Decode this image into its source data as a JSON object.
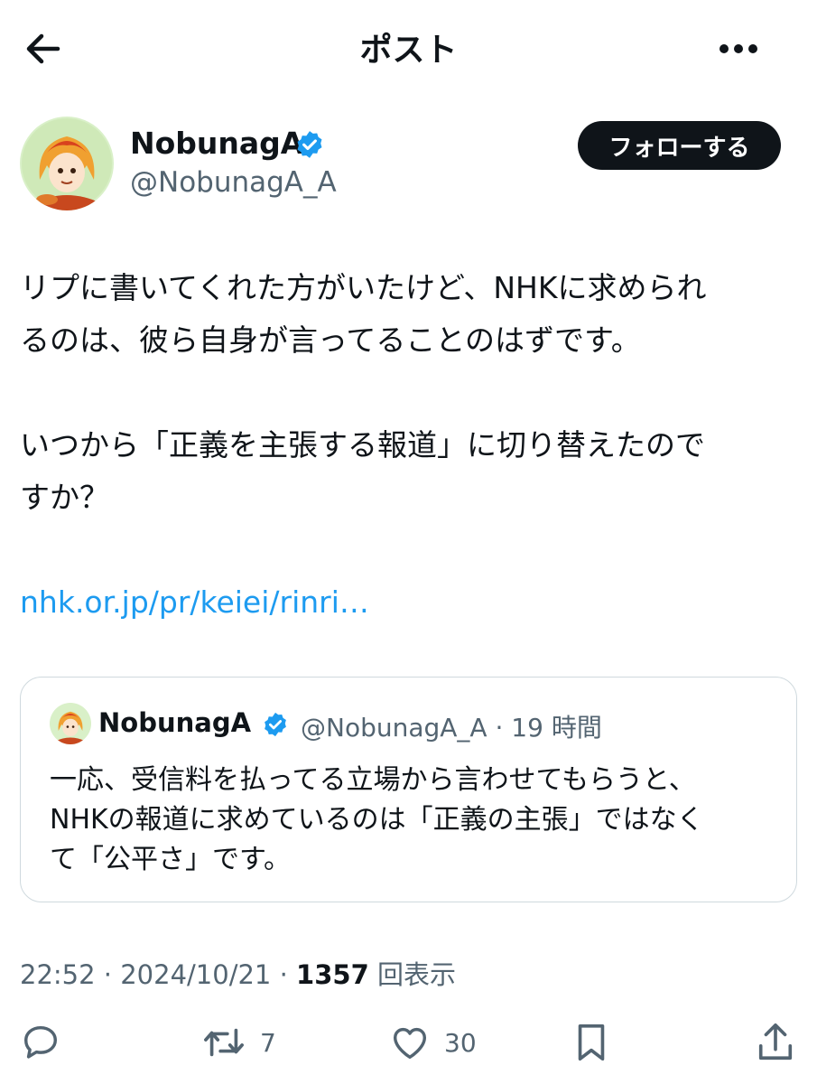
{
  "header": {
    "title": "ポスト"
  },
  "author": {
    "name": "NobunagA",
    "handle": "@NobunagA_A",
    "follow_label": "フォローする"
  },
  "post": {
    "line1": "リプに書いてくれた方がいたけど、NHKに求められ",
    "line2": "るのは、彼ら自身が言ってることのはずです。",
    "line3": "いつから「正義を主張する報道」に切り替えたので",
    "line4": "すか？",
    "link": "nhk.or.jp/pr/keiei/rinri…"
  },
  "quote": {
    "name": "NobunagA",
    "meta": "@NobunagA_A · 19 時間",
    "line1": "一応、受信料を払ってる立場から言わせてもらうと、",
    "line2": "NHKの報道に求めているのは「正義の主張」ではなく",
    "line3": "て「公平さ」です。"
  },
  "stats": {
    "time": "22:52 · 2024/10/21 · ",
    "views_count": "1357",
    "views_label": "回表示"
  },
  "actions": {
    "retweets": "7",
    "likes": "30"
  },
  "icons": {
    "back": "arrow-left-icon",
    "more": "more-horizontal-icon",
    "verified": "verified-badge-icon",
    "reply": "reply-icon",
    "retweet": "retweet-icon",
    "like": "heart-icon",
    "bookmark": "bookmark-icon",
    "share": "share-icon"
  },
  "colors": {
    "accent": "#1d9bf0",
    "text": "#0f1419",
    "secondary": "#536471"
  }
}
